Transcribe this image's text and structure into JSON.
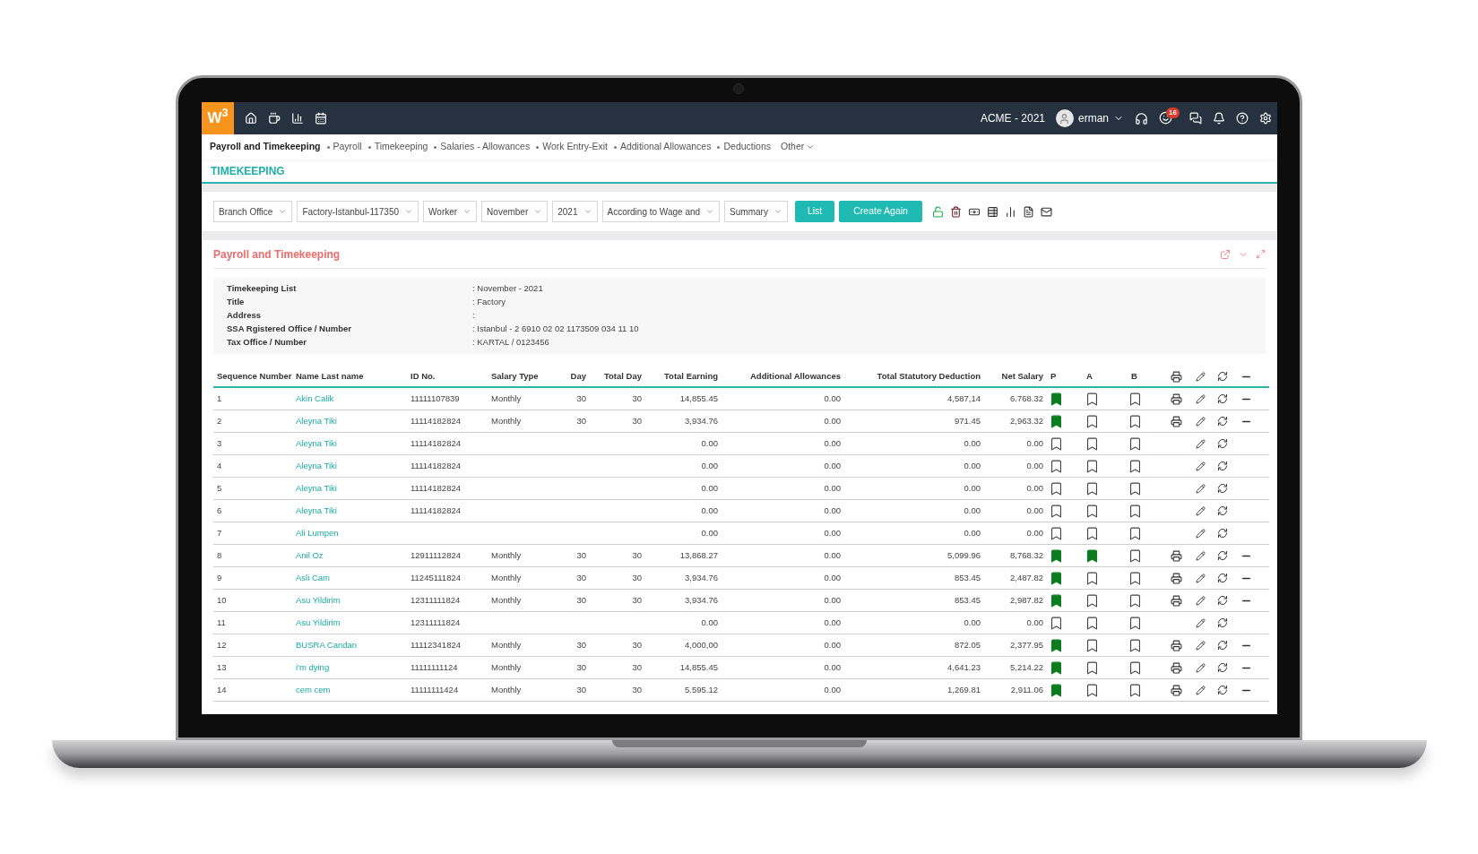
{
  "topbar": {
    "logo": "W$^{3}$",
    "company": "ACME - 2021",
    "user": "erman",
    "notification_count": "16"
  },
  "nav": {
    "items": [
      {
        "label": "Payroll and Timekeeping",
        "selected": true
      },
      {
        "label": "Payroll",
        "selected": false
      },
      {
        "label": "Timekeeping",
        "selected": false
      },
      {
        "label": "Salaries - Allowances",
        "selected": false
      },
      {
        "label": "Work Entry-Exit",
        "selected": false
      },
      {
        "label": "Additional Allowances",
        "selected": false
      },
      {
        "label": "Deductions",
        "selected": false
      }
    ],
    "more": "Other"
  },
  "page_title": "TIMEKEEPING",
  "filters": [
    "Branch Office",
    "Factory-Istanbul-117350",
    "Worker",
    "November",
    "2021",
    "According to Wage and",
    "Summary"
  ],
  "buttons": [
    "List",
    "Create Again"
  ],
  "card": {
    "title": "Payroll and Timekeeping",
    "info": [
      {
        "label": "Timekeeping List",
        "value": ": November - 2021"
      },
      {
        "label": "Title",
        "value": ": Factory"
      },
      {
        "label": "Address",
        "value": ":"
      },
      {
        "label": "SSA Rgistered Office / Number",
        "value": ": Istanbul - 2 6910 02 02 1173509 034 11 10"
      },
      {
        "label": "Tax Office / Number",
        "value": ": KARTAL / 0123456"
      }
    ]
  },
  "table": {
    "columns": [
      "Sequence Number",
      "Name Last name",
      "ID No.",
      "Salary Type",
      "Day",
      "Total Day",
      "Total Earning",
      "Additional Allowances",
      "Total Statutory Deduction",
      "Net Salary",
      "P",
      "A",
      "B"
    ],
    "rows": [
      {
        "seq": "1",
        "name": "Akin Calik",
        "id": "11111107839",
        "salary_type": "Monthly",
        "day": "30",
        "total_day": "30",
        "total_earning": "14,855.45",
        "additional_allowances": "0.00",
        "total_statutory_deduction": "4,587,14",
        "net_salary": "6.768.32",
        "p": true,
        "a": false,
        "b": false,
        "printable": true
      },
      {
        "seq": "2",
        "name": "Aleyna Tiki",
        "id": "11114182824",
        "salary_type": "Monthly",
        "day": "30",
        "total_day": "30",
        "total_earning": "3,934.76",
        "additional_allowances": "0.00",
        "total_statutory_deduction": "971.45",
        "net_salary": "2,963.32",
        "p": true,
        "a": false,
        "b": false,
        "printable": true
      },
      {
        "seq": "3",
        "name": "Aleyna Tiki",
        "id": "11114182824",
        "total_earning": "0.00",
        "additional_allowances": "0.00",
        "total_statutory_deduction": "0.00",
        "net_salary": "0.00",
        "p": false,
        "a": false,
        "b": false,
        "printable": false
      },
      {
        "seq": "4",
        "name": "Aleyna Tiki",
        "id": "11114182824",
        "total_earning": "0.00",
        "additional_allowances": "0.00",
        "total_statutory_deduction": "0.00",
        "net_salary": "0.00",
        "p": false,
        "a": false,
        "b": false,
        "printable": false
      },
      {
        "seq": "5",
        "name": "Aleyna Tiki",
        "id": "11114182824",
        "total_earning": "0.00",
        "additional_allowances": "0.00",
        "total_statutory_deduction": "0.00",
        "net_salary": "0.00",
        "p": false,
        "a": false,
        "b": false,
        "printable": false
      },
      {
        "seq": "6",
        "name": "Aleyna Tiki",
        "id": "11114182824",
        "total_earning": "0.00",
        "additional_allowances": "0.00",
        "total_statutory_deduction": "0.00",
        "net_salary": "0.00",
        "p": false,
        "a": false,
        "b": false,
        "printable": false
      },
      {
        "seq": "7",
        "name": "Ali Lumpen",
        "total_earning": "0.00",
        "additional_allowances": "0.00",
        "total_statutory_deduction": "0.00",
        "net_salary": "0.00",
        "p": false,
        "a": false,
        "b": false,
        "printable": false
      },
      {
        "seq": "8",
        "name": "Anil Oz",
        "id": "12911112824",
        "salary_type": "Monthly",
        "day": "30",
        "total_day": "30",
        "total_earning": "13,868.27",
        "additional_allowances": "0.00",
        "total_statutory_deduction": "5,099.96",
        "net_salary": "8,768.32",
        "p": true,
        "a": true,
        "b": false,
        "printable": true
      },
      {
        "seq": "9",
        "name": "Asli Cam",
        "id": "11245111824",
        "salary_type": "Monthly",
        "day": "30",
        "total_day": "30",
        "total_earning": "3,934.76",
        "additional_allowances": "0.00",
        "total_statutory_deduction": "853.45",
        "net_salary": "2,487.82",
        "p": true,
        "a": false,
        "b": false,
        "printable": true
      },
      {
        "seq": "10",
        "name": "Asu Yildirim",
        "id": "12311111824",
        "salary_type": "Monthly",
        "day": "30",
        "total_day": "30",
        "total_earning": "3,934.76",
        "additional_allowances": "0.00",
        "total_statutory_deduction": "853.45",
        "net_salary": "2,987.82",
        "p": true,
        "a": false,
        "b": false,
        "printable": true
      },
      {
        "seq": "11",
        "name": "Asu Yildirim",
        "id": "12311111824",
        "total_earning": "0.00",
        "additional_allowances": "0.00",
        "total_statutory_deduction": "0.00",
        "net_salary": "0.00",
        "p": false,
        "a": false,
        "b": false,
        "printable": false
      },
      {
        "seq": "12",
        "name": "BUSRA Candan",
        "id": "11112341824",
        "salary_type": "Monthly",
        "day": "30",
        "total_day": "30",
        "total_earning": "4,000,00",
        "additional_allowances": "0.00",
        "total_statutory_deduction": "872.05",
        "net_salary": "2,377.95",
        "p": true,
        "a": false,
        "b": false,
        "printable": true
      },
      {
        "seq": "13",
        "name": "i'm dying",
        "id": "11111111124",
        "salary_type": "Monthly",
        "day": "30",
        "total_day": "30",
        "total_earning": "14,855.45",
        "additional_allowances": "0.00",
        "total_statutory_deduction": "4,641.23",
        "net_salary": "5,214.22",
        "p": true,
        "a": false,
        "b": false,
        "printable": true
      },
      {
        "seq": "14",
        "name": "cem cem",
        "id": "11111111424",
        "salary_type": "Monthly",
        "day": "30",
        "total_day": "30",
        "total_earning": "5.595.12",
        "additional_allowances": "0.00",
        "total_statutory_deduction": "1,269.81",
        "net_salary": "2,911.06",
        "p": true,
        "a": false,
        "b": false,
        "printable": true
      }
    ]
  }
}
